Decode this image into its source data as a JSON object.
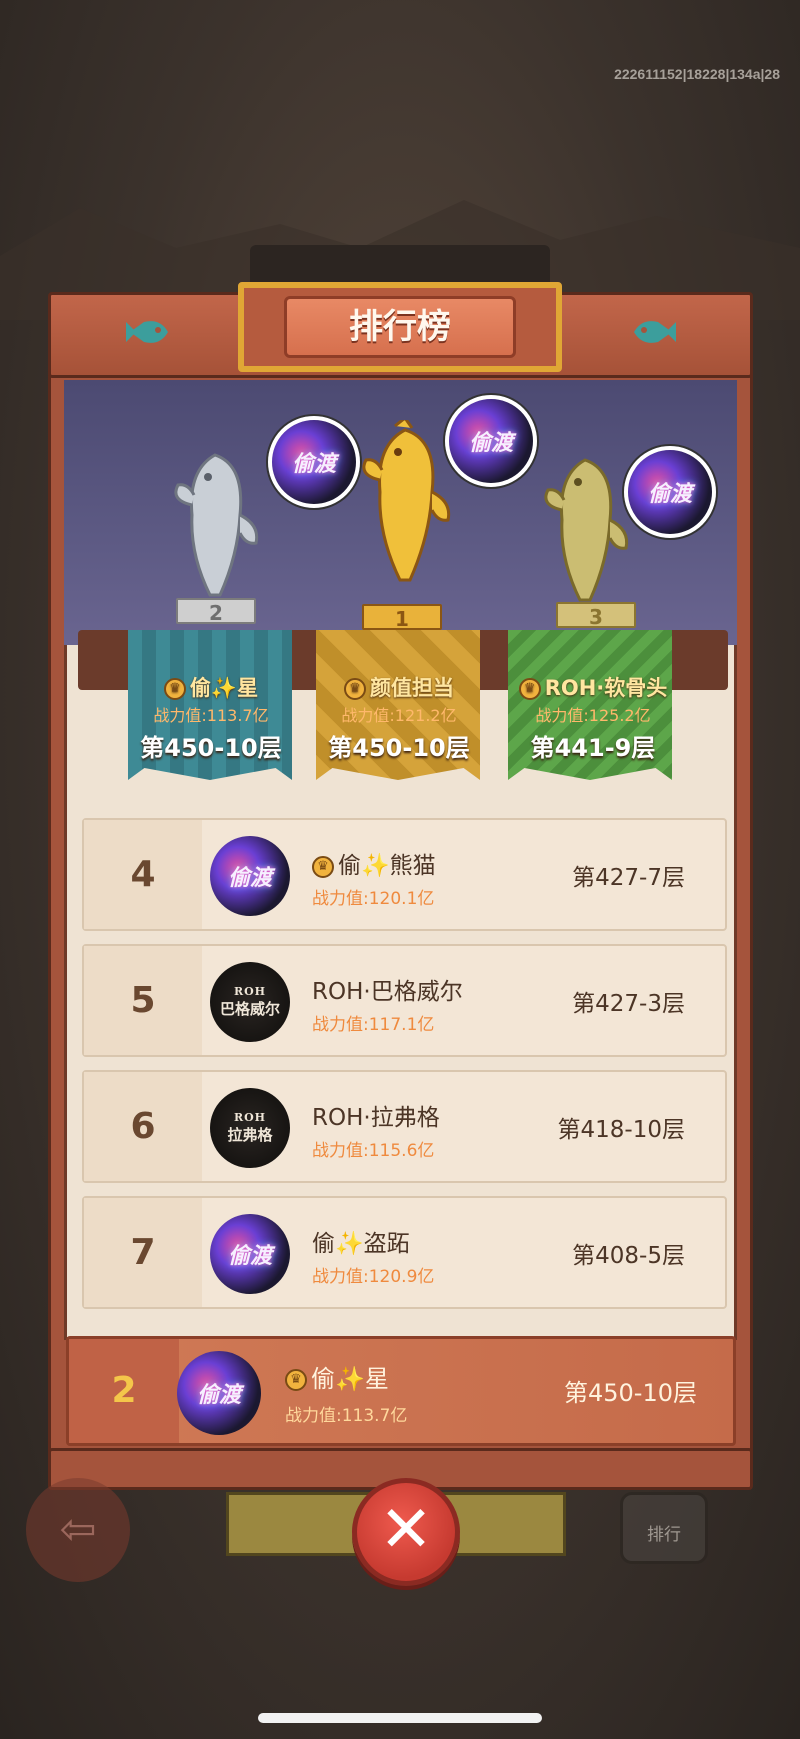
{
  "debug": {
    "text": "222611152|18228|134a|28"
  },
  "title": "排行榜",
  "podium": [
    {
      "rank": "2",
      "pedestal_label": "2",
      "name": "偷✨星",
      "power": "战力值:113.7亿",
      "floor": "第450-10层",
      "avatar_text": "偷渡",
      "color": "#3e8a95"
    },
    {
      "rank": "1",
      "pedestal_label": "1",
      "name": "颜值担当",
      "power": "战力值:121.2亿",
      "floor": "第450-10层",
      "avatar_text": "偷渡",
      "color": "#d5a33a"
    },
    {
      "rank": "3",
      "pedestal_label": "3",
      "name": "ROH·软骨头",
      "power": "战力值:125.2亿",
      "floor": "第441-9层",
      "avatar_text": "偷渡",
      "color": "#5da64a"
    }
  ],
  "rows": [
    {
      "rank": "4",
      "name": "偷✨熊猫",
      "power": "战力值:120.1亿",
      "floor": "第427-7层",
      "avatar_text": "偷渡",
      "crown": true
    },
    {
      "rank": "5",
      "name": "ROH·巴格威尔",
      "power": "战力值:117.1亿",
      "floor": "第427-3层",
      "avatar_top": "ROH",
      "avatar_main": "巴格威尔"
    },
    {
      "rank": "6",
      "name": "ROH·拉弗格",
      "power": "战力值:115.6亿",
      "floor": "第418-10层",
      "avatar_top": "ROH",
      "avatar_main": "拉弗格"
    },
    {
      "rank": "7",
      "name": "偷✨盗跖",
      "power": "战力值:120.9亿",
      "floor": "第408-5层",
      "avatar_text": "偷渡"
    }
  ],
  "self": {
    "rank": "2",
    "name": "偷✨星",
    "power": "战力值:113.7亿",
    "floor": "第450-10层",
    "avatar_text": "偷渡"
  },
  "buttons": {
    "close": "✕",
    "back": "⇦",
    "rank_label": "排行"
  },
  "icons": {
    "fish": "fish-icon",
    "crown": "crown-icon",
    "close": "close-icon",
    "back": "back-arrow-icon"
  },
  "colors": {
    "frame": "#a5543c",
    "title_gold": "#e0a735",
    "power_orange": "#ef8a3e",
    "stage": "#4c4a72"
  }
}
